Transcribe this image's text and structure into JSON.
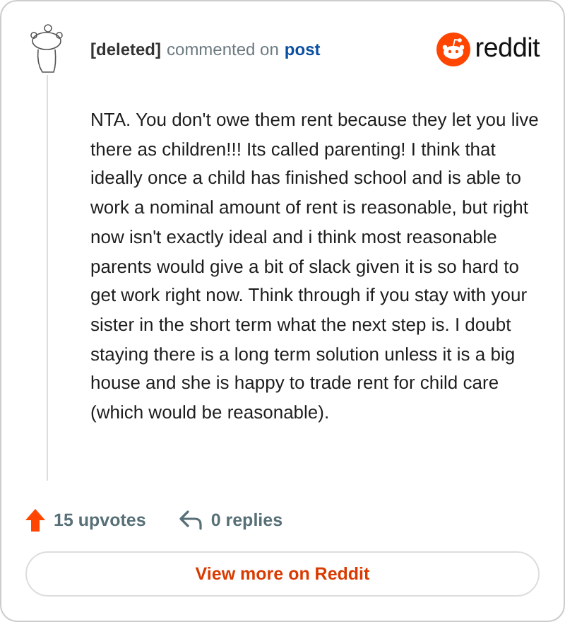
{
  "header": {
    "author": "[deleted]",
    "action": "commented on",
    "link": "post",
    "logo": "reddit"
  },
  "comment": "NTA. You don't owe them rent because they let you live there as children!!! Its called parenting! I think that ideally once a child has finished school and is able to work a nominal amount of rent is reasonable, but right now isn't exactly ideal and i think most reasonable parents would give a bit of slack given it is so hard to get work right now. Think through if you stay with your sister in the short term what the next step is. I doubt staying there is a long term solution unless it is a big house and she is happy to trade rent for child care (which would be reasonable).",
  "footer": {
    "upvotes": "15 upvotes",
    "replies": "0 replies"
  },
  "button": "View more on Reddit"
}
